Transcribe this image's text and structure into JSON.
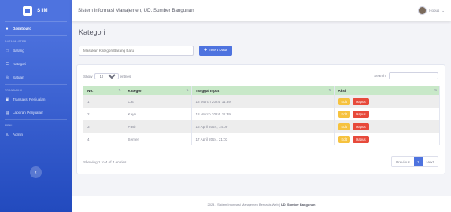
{
  "sidebar": {
    "brand": "SIM",
    "items": [
      {
        "label": "Dashboard",
        "icon": "tachometer-icon",
        "active": true
      },
      {
        "heading": "DATA MASTER"
      },
      {
        "label": "Barang",
        "icon": "box-icon"
      },
      {
        "label": "Kategori",
        "icon": "list-icon"
      },
      {
        "label": "Satuan",
        "icon": "ruler-icon"
      },
      {
        "heading": "TRANSAKSI"
      },
      {
        "label": "Transaksi Penjualan",
        "icon": "cart-icon"
      },
      {
        "label": "Laporan Penjualan",
        "icon": "report-icon"
      },
      {
        "heading": "MENU"
      },
      {
        "label": "Admin",
        "icon": "user-icon"
      }
    ]
  },
  "topbar": {
    "title": "Sistem Informasi Manajemen, UD. Sumber Bangunan",
    "user": "Hoous"
  },
  "page": {
    "title": "Kategori",
    "input_placeholder": "Masukan Kategori Barang Baru",
    "insert_label": "Insert Data"
  },
  "table": {
    "show_label": "Show",
    "entries_label": "entries",
    "length_value": "10",
    "search_label": "Search:",
    "columns": [
      "No.",
      "Kategori",
      "Tanggal Input",
      "Aksi"
    ],
    "rows": [
      {
        "no": "1",
        "kategori": "Cat",
        "tanggal": "18 March 2024, 11:39"
      },
      {
        "no": "2",
        "kategori": "Kayu",
        "tanggal": "18 March 2024, 11:39"
      },
      {
        "no": "3",
        "kategori": "Pasir",
        "tanggal": "16 April 2024, 14:09"
      },
      {
        "no": "4",
        "kategori": "Semen",
        "tanggal": "17 April 2024, 21:03"
      }
    ],
    "edit_label": "Edit",
    "delete_label": "Hapus",
    "info": "Showing 1 to 4 of 4 entries",
    "prev_label": "Previous",
    "page_number": "1",
    "next_label": "Next"
  },
  "footer": {
    "text": "2024 - Sistem Informasi Manajemen Berbasis Web |",
    "owner": "UD. Sumber Bangunan"
  },
  "colors": {
    "primary": "#4e73df",
    "warning": "#f6c23e",
    "danger": "#e74a3b",
    "table_header": "#c8e8c8"
  }
}
